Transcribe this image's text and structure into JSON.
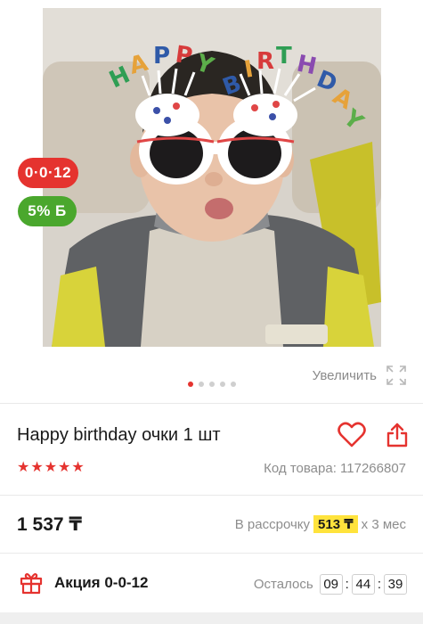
{
  "product": {
    "title": "Happy birthday очки 1 шт",
    "rating_stars": 5,
    "sku_label": "Код товара: 117266807",
    "price": "1 537 ₸"
  },
  "badges": {
    "installment": "0·0·12",
    "bonus": "5% Б"
  },
  "gallery": {
    "zoom_label": "Увеличить",
    "image_count": 5,
    "active_index": 0,
    "glasses_text": [
      "HAPPY",
      "BIRTHDAY"
    ]
  },
  "installment": {
    "prefix": "В рассрочку",
    "amount": "513 ₸",
    "suffix": "х 3 мес"
  },
  "promo": {
    "label": "Акция 0-0-12",
    "timer_label": "Осталось",
    "hours": "09",
    "minutes": "44",
    "seconds": "39"
  },
  "colors": {
    "accent_red": "#e5332f",
    "bonus_green": "#4aa72d",
    "highlight_yellow": "#ffe33c"
  }
}
